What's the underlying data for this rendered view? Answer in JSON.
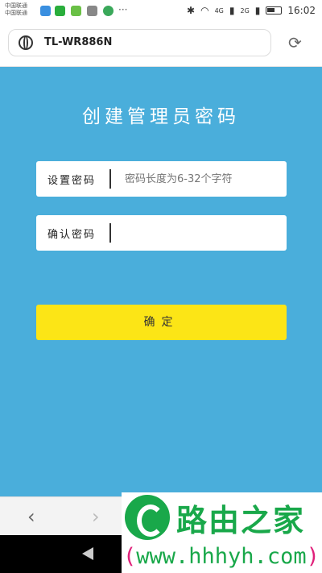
{
  "status_bar": {
    "carrier_line1": "中国联通",
    "carrier_line2": "中国联通",
    "network": "4G",
    "network2": "2G",
    "time": "16:02",
    "app_icon_colors": [
      "#3a8fe0",
      "#2aae3c",
      "#6ac046",
      "#888888",
      "#3aa85a"
    ],
    "more": "···"
  },
  "address_bar": {
    "url": "TL-WR886N"
  },
  "page": {
    "title": "创建管理员密码",
    "set_password_label": "设置密码",
    "set_password_placeholder": "密码长度为6-32个字符",
    "confirm_password_label": "确认密码",
    "confirm_password_value": "",
    "confirm_button": "确定"
  },
  "browser_nav": {
    "back": "‹",
    "forward": "›"
  },
  "watermark": {
    "name": "路由之家",
    "url_open": "(",
    "url": "www.hhhyh.com",
    "url_close": ")"
  },
  "colors": {
    "background": "#4aaedb",
    "button": "#fce516",
    "watermark_green": "#19a84a"
  }
}
